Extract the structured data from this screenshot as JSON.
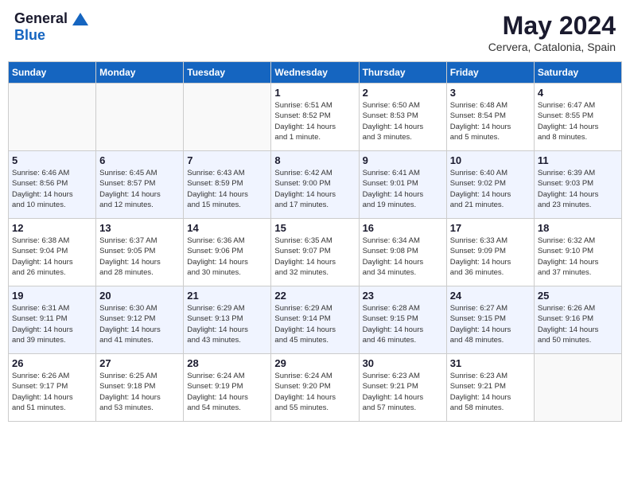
{
  "header": {
    "logo_line1": "General",
    "logo_line2": "Blue",
    "month_year": "May 2024",
    "location": "Cervera, Catalonia, Spain"
  },
  "days_of_week": [
    "Sunday",
    "Monday",
    "Tuesday",
    "Wednesday",
    "Thursday",
    "Friday",
    "Saturday"
  ],
  "weeks": [
    [
      {
        "day": "",
        "info": ""
      },
      {
        "day": "",
        "info": ""
      },
      {
        "day": "",
        "info": ""
      },
      {
        "day": "1",
        "info": "Sunrise: 6:51 AM\nSunset: 8:52 PM\nDaylight: 14 hours\nand 1 minute."
      },
      {
        "day": "2",
        "info": "Sunrise: 6:50 AM\nSunset: 8:53 PM\nDaylight: 14 hours\nand 3 minutes."
      },
      {
        "day": "3",
        "info": "Sunrise: 6:48 AM\nSunset: 8:54 PM\nDaylight: 14 hours\nand 5 minutes."
      },
      {
        "day": "4",
        "info": "Sunrise: 6:47 AM\nSunset: 8:55 PM\nDaylight: 14 hours\nand 8 minutes."
      }
    ],
    [
      {
        "day": "5",
        "info": "Sunrise: 6:46 AM\nSunset: 8:56 PM\nDaylight: 14 hours\nand 10 minutes."
      },
      {
        "day": "6",
        "info": "Sunrise: 6:45 AM\nSunset: 8:57 PM\nDaylight: 14 hours\nand 12 minutes."
      },
      {
        "day": "7",
        "info": "Sunrise: 6:43 AM\nSunset: 8:59 PM\nDaylight: 14 hours\nand 15 minutes."
      },
      {
        "day": "8",
        "info": "Sunrise: 6:42 AM\nSunset: 9:00 PM\nDaylight: 14 hours\nand 17 minutes."
      },
      {
        "day": "9",
        "info": "Sunrise: 6:41 AM\nSunset: 9:01 PM\nDaylight: 14 hours\nand 19 minutes."
      },
      {
        "day": "10",
        "info": "Sunrise: 6:40 AM\nSunset: 9:02 PM\nDaylight: 14 hours\nand 21 minutes."
      },
      {
        "day": "11",
        "info": "Sunrise: 6:39 AM\nSunset: 9:03 PM\nDaylight: 14 hours\nand 23 minutes."
      }
    ],
    [
      {
        "day": "12",
        "info": "Sunrise: 6:38 AM\nSunset: 9:04 PM\nDaylight: 14 hours\nand 26 minutes."
      },
      {
        "day": "13",
        "info": "Sunrise: 6:37 AM\nSunset: 9:05 PM\nDaylight: 14 hours\nand 28 minutes."
      },
      {
        "day": "14",
        "info": "Sunrise: 6:36 AM\nSunset: 9:06 PM\nDaylight: 14 hours\nand 30 minutes."
      },
      {
        "day": "15",
        "info": "Sunrise: 6:35 AM\nSunset: 9:07 PM\nDaylight: 14 hours\nand 32 minutes."
      },
      {
        "day": "16",
        "info": "Sunrise: 6:34 AM\nSunset: 9:08 PM\nDaylight: 14 hours\nand 34 minutes."
      },
      {
        "day": "17",
        "info": "Sunrise: 6:33 AM\nSunset: 9:09 PM\nDaylight: 14 hours\nand 36 minutes."
      },
      {
        "day": "18",
        "info": "Sunrise: 6:32 AM\nSunset: 9:10 PM\nDaylight: 14 hours\nand 37 minutes."
      }
    ],
    [
      {
        "day": "19",
        "info": "Sunrise: 6:31 AM\nSunset: 9:11 PM\nDaylight: 14 hours\nand 39 minutes."
      },
      {
        "day": "20",
        "info": "Sunrise: 6:30 AM\nSunset: 9:12 PM\nDaylight: 14 hours\nand 41 minutes."
      },
      {
        "day": "21",
        "info": "Sunrise: 6:29 AM\nSunset: 9:13 PM\nDaylight: 14 hours\nand 43 minutes."
      },
      {
        "day": "22",
        "info": "Sunrise: 6:29 AM\nSunset: 9:14 PM\nDaylight: 14 hours\nand 45 minutes."
      },
      {
        "day": "23",
        "info": "Sunrise: 6:28 AM\nSunset: 9:15 PM\nDaylight: 14 hours\nand 46 minutes."
      },
      {
        "day": "24",
        "info": "Sunrise: 6:27 AM\nSunset: 9:15 PM\nDaylight: 14 hours\nand 48 minutes."
      },
      {
        "day": "25",
        "info": "Sunrise: 6:26 AM\nSunset: 9:16 PM\nDaylight: 14 hours\nand 50 minutes."
      }
    ],
    [
      {
        "day": "26",
        "info": "Sunrise: 6:26 AM\nSunset: 9:17 PM\nDaylight: 14 hours\nand 51 minutes."
      },
      {
        "day": "27",
        "info": "Sunrise: 6:25 AM\nSunset: 9:18 PM\nDaylight: 14 hours\nand 53 minutes."
      },
      {
        "day": "28",
        "info": "Sunrise: 6:24 AM\nSunset: 9:19 PM\nDaylight: 14 hours\nand 54 minutes."
      },
      {
        "day": "29",
        "info": "Sunrise: 6:24 AM\nSunset: 9:20 PM\nDaylight: 14 hours\nand 55 minutes."
      },
      {
        "day": "30",
        "info": "Sunrise: 6:23 AM\nSunset: 9:21 PM\nDaylight: 14 hours\nand 57 minutes."
      },
      {
        "day": "31",
        "info": "Sunrise: 6:23 AM\nSunset: 9:21 PM\nDaylight: 14 hours\nand 58 minutes."
      },
      {
        "day": "",
        "info": ""
      }
    ]
  ]
}
